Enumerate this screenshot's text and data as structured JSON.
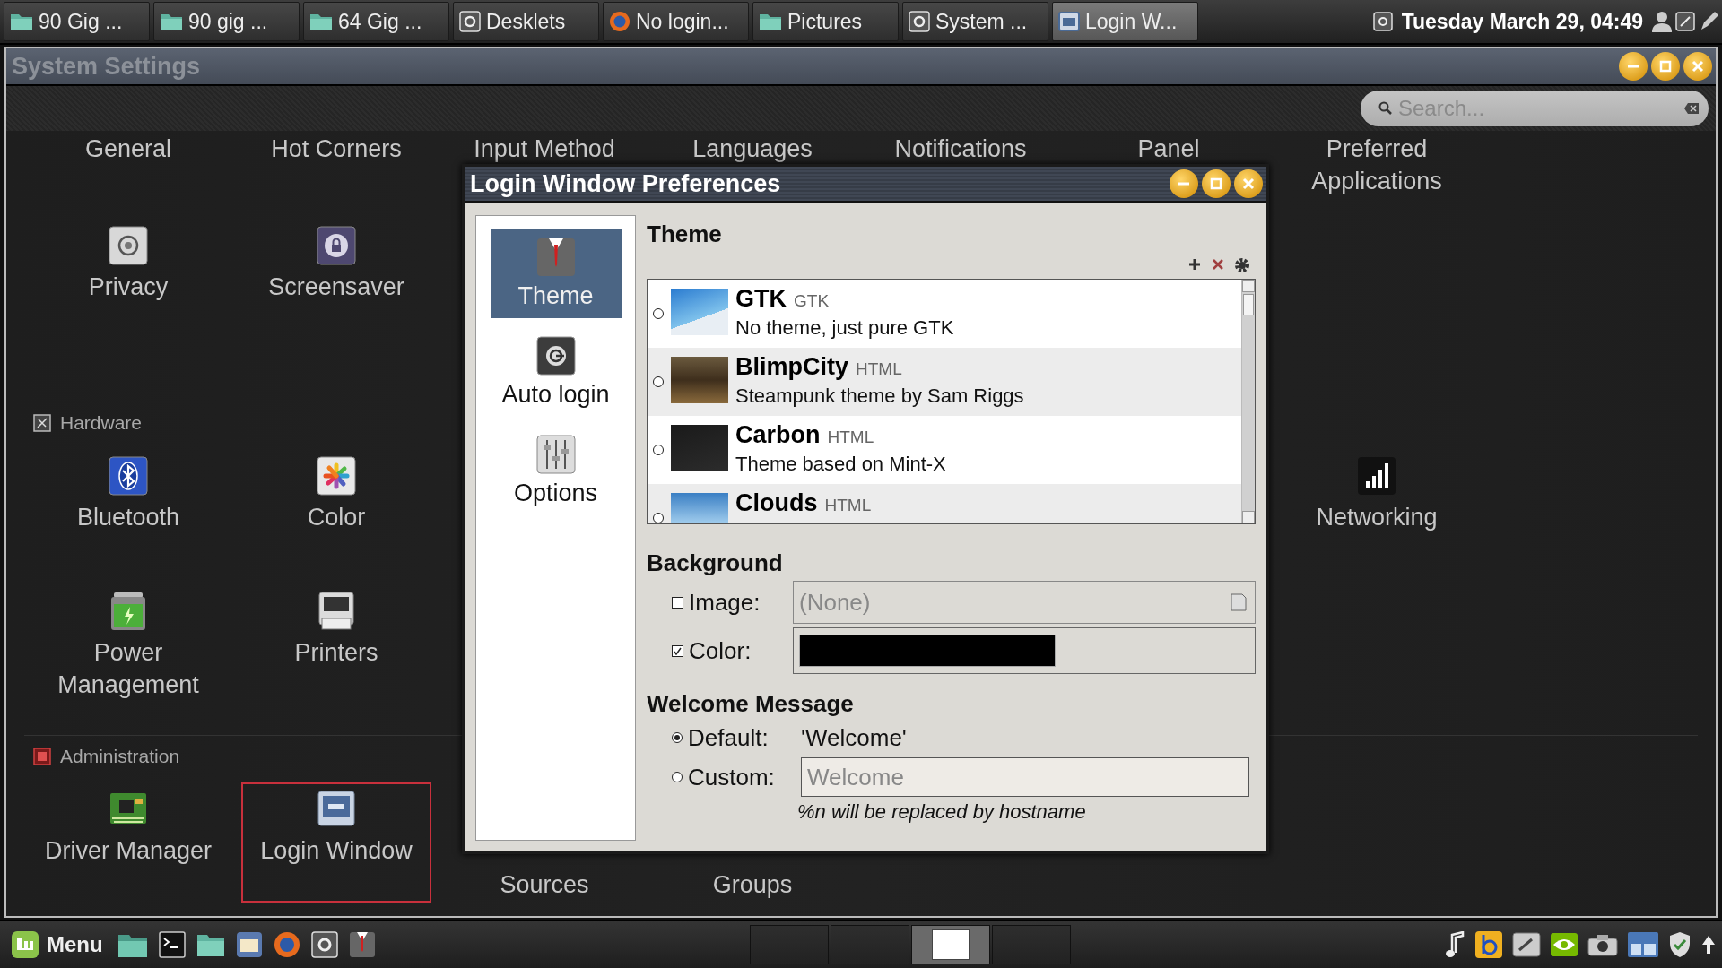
{
  "top_panel": {
    "windows": [
      {
        "label": "90 Gig ...",
        "selected": false
      },
      {
        "label": "90 gig ...",
        "selected": false
      },
      {
        "label": "64 Gig ...",
        "selected": false
      },
      {
        "label": "Desklets",
        "selected": false
      },
      {
        "label": "No login...",
        "selected": false
      },
      {
        "label": "Pictures",
        "selected": false
      },
      {
        "label": "System ...",
        "selected": false
      },
      {
        "label": "Login W...",
        "selected": true
      }
    ],
    "clock": "Tuesday March 29, 04:49"
  },
  "settings_window": {
    "title": "System Settings",
    "search": {
      "placeholder": "Search..."
    },
    "sections": [
      {
        "rows": [
          [
            {
              "kind": "label_only",
              "label": "General"
            },
            {
              "kind": "label_only",
              "label": "Hot Corners"
            },
            {
              "kind": "label_only",
              "label": "Input Method"
            },
            {
              "kind": "label_only",
              "label": "Languages"
            },
            {
              "kind": "label_only",
              "label": "Notifications"
            },
            {
              "kind": "label_only",
              "label": "Panel"
            },
            {
              "kind": "label_only",
              "label": "Preferred Applications"
            }
          ],
          [
            {
              "kind": "item",
              "label": "Privacy",
              "selected": false
            },
            {
              "kind": "item",
              "label": "Screensaver",
              "selected": false
            }
          ]
        ]
      },
      {
        "header": "Hardware",
        "rows": [
          [
            {
              "kind": "item",
              "label": "Bluetooth",
              "selected": false
            },
            {
              "kind": "item",
              "label": "Color",
              "selected": false
            },
            {
              "kind": "covered"
            },
            {
              "kind": "covered"
            },
            {
              "kind": "covered"
            },
            {
              "kind": "covered"
            },
            {
              "kind": "item",
              "label": "Networking",
              "selected": false
            }
          ],
          [
            {
              "kind": "item",
              "label": "Power Management",
              "selected": false
            },
            {
              "kind": "item",
              "label": "Printers",
              "selected": false
            }
          ]
        ]
      },
      {
        "header": "Administration",
        "rows": [
          [
            {
              "kind": "item",
              "label": "Driver Manager",
              "selected": false
            },
            {
              "kind": "item",
              "label": "Login Window",
              "selected": true
            },
            {
              "kind": "label_tail",
              "label": "Sources"
            },
            {
              "kind": "label_tail",
              "label": "Groups"
            }
          ]
        ]
      }
    ]
  },
  "dialog": {
    "title": "Login Window Preferences",
    "sidebar": [
      {
        "label": "Theme",
        "selected": true
      },
      {
        "label": "Auto login",
        "selected": false
      },
      {
        "label": "Options",
        "selected": false
      }
    ],
    "theme": {
      "heading": "Theme",
      "themes": [
        {
          "name": "GTK",
          "type": "GTK",
          "description": "No theme, just pure GTK",
          "selected": false
        },
        {
          "name": "BlimpCity",
          "type": "HTML",
          "description": "Steampunk theme by Sam Riggs",
          "selected": false
        },
        {
          "name": "Carbon",
          "type": "HTML",
          "description": "Theme based on Mint-X",
          "selected": false
        },
        {
          "name": "Clouds",
          "type": "HTML",
          "selected": false
        }
      ]
    },
    "background": {
      "heading": "Background",
      "image": {
        "label": "Image:",
        "checked": false,
        "placeholder": "(None)"
      },
      "color": {
        "label": "Color:",
        "checked": true
      }
    },
    "welcome": {
      "heading": "Welcome Message",
      "options": [
        {
          "kind": "fixed",
          "label": "Default:",
          "selected": true,
          "value": "'Welcome'"
        },
        {
          "kind": "entry",
          "label": "Custom:",
          "selected": false,
          "placeholder": "Welcome"
        }
      ],
      "hint": "%n will be replaced by hostname"
    }
  },
  "bottom_panel": {
    "menu": "Menu",
    "workspaces": [
      {
        "selected": false
      },
      {
        "selected": false
      },
      {
        "selected": true
      },
      {
        "selected": false
      }
    ]
  }
}
